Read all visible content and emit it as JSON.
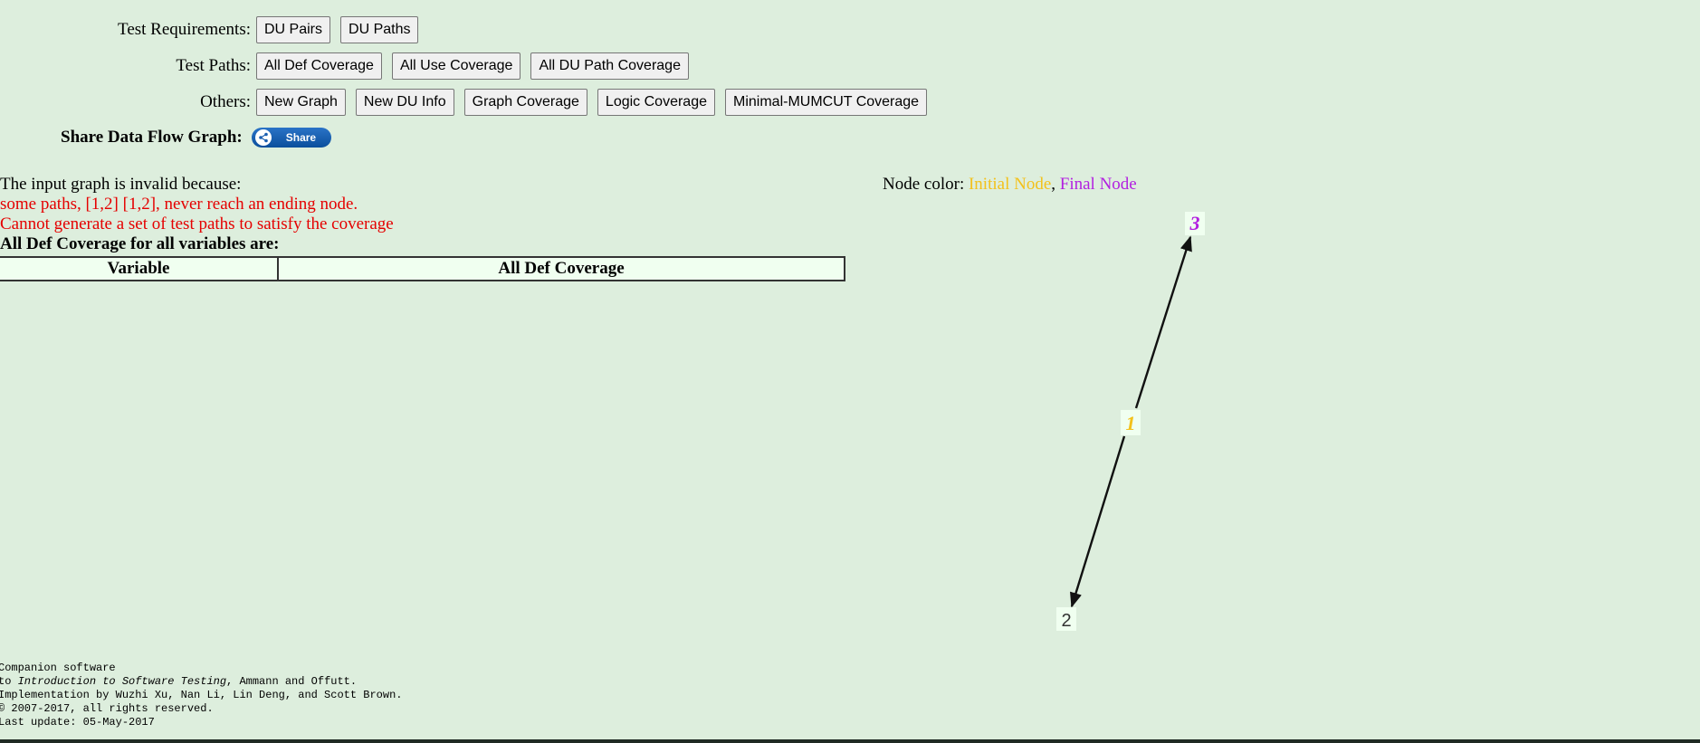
{
  "toolbar": {
    "test_requirements": {
      "label": "Test Requirements:",
      "buttons": [
        "DU Pairs",
        "DU Paths"
      ]
    },
    "test_paths": {
      "label": "Test Paths:",
      "buttons": [
        "All Def Coverage",
        "All Use Coverage",
        "All DU Path Coverage"
      ]
    },
    "others": {
      "label": "Others:",
      "buttons": [
        "New Graph",
        "New DU Info",
        "Graph Coverage",
        "Logic Coverage",
        "Minimal-MUMCUT Coverage"
      ]
    }
  },
  "share": {
    "label": "Share Data Flow Graph:",
    "button_label": "Share"
  },
  "messages": {
    "invalid_intro": "The input graph is invalid because:",
    "error_paths": "some paths, [1,2] [1,2], never reach an ending node.",
    "error_generate": "Cannot generate a set of test paths to satisfy the coverage",
    "coverage_heading": "All Def Coverage for all variables are:"
  },
  "coverage_table": {
    "headers": [
      "Variable",
      "All Def Coverage"
    ],
    "rows": []
  },
  "legend": {
    "prefix": "Node color: ",
    "initial": "Initial Node",
    "separator": ", ",
    "final": "Final Node"
  },
  "graph": {
    "nodes": [
      {
        "id": "1",
        "type": "initial",
        "color": "#f3c11b"
      },
      {
        "id": "2",
        "type": "normal",
        "color": "#333333"
      },
      {
        "id": "3",
        "type": "final",
        "color": "#b21fe0"
      }
    ],
    "edges": [
      {
        "from": "1",
        "to": "2"
      },
      {
        "from": "1",
        "to": "3"
      }
    ]
  },
  "footer": {
    "line1": "Companion software",
    "line2_prefix": "to ",
    "line2_book": "Introduction to Software Testing",
    "line2_suffix": ", Ammann and Offutt.",
    "line3": "Implementation by Wuzhi Xu, Nan Li, Lin Deng, and Scott Brown.",
    "line4": "© 2007-2017, all rights reserved.",
    "line5": "Last update: 05-May-2017"
  }
}
